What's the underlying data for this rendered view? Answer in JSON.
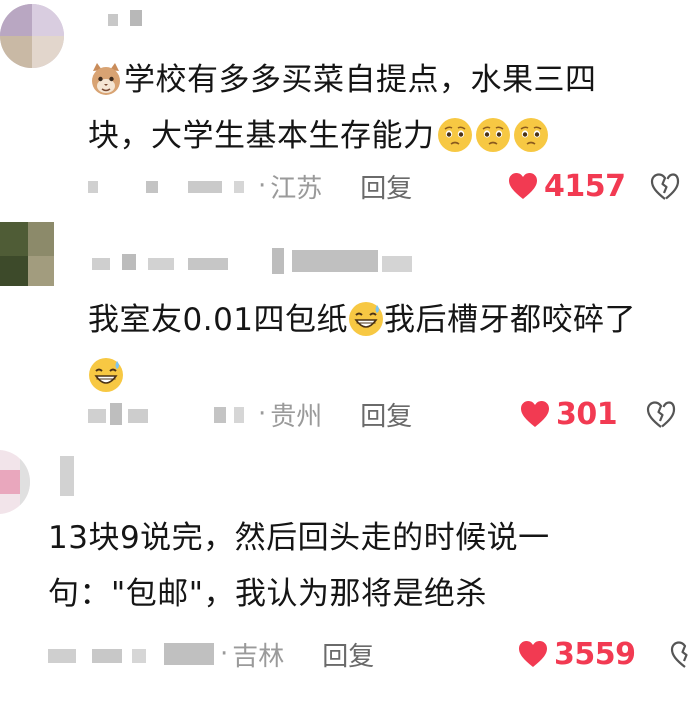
{
  "comments": [
    {
      "text_parts": [
        "学校有多多买菜自提点，水果三四",
        "块，大学生基本生存能力"
      ],
      "region": "江苏",
      "reply_label": "回复",
      "likes": "4157",
      "emojis": [
        "cat-face",
        "pleading-face",
        "pleading-face",
        "pleading-face"
      ]
    },
    {
      "text_before_emoji": "我室友0.01四包纸",
      "text_after_emoji": "我后槽牙都咬碎了",
      "region": "贵州",
      "reply_label": "回复",
      "likes": "301",
      "emojis": [
        "grinning-sweat-face",
        "grinning-sweat-face"
      ]
    },
    {
      "text_line1": "13块9说完，然后回头走的时候说一",
      "text_line2": "句：\"包邮\"，我认为那将是绝杀",
      "region": "吉林",
      "reply_label": "回复",
      "likes": "3559",
      "emojis": []
    }
  ],
  "separator": "·",
  "colors": {
    "like_red": "#f23a52",
    "meta_gray": "#9a9a9a",
    "reply_gray": "#6a6a6a",
    "text": "#151515"
  }
}
